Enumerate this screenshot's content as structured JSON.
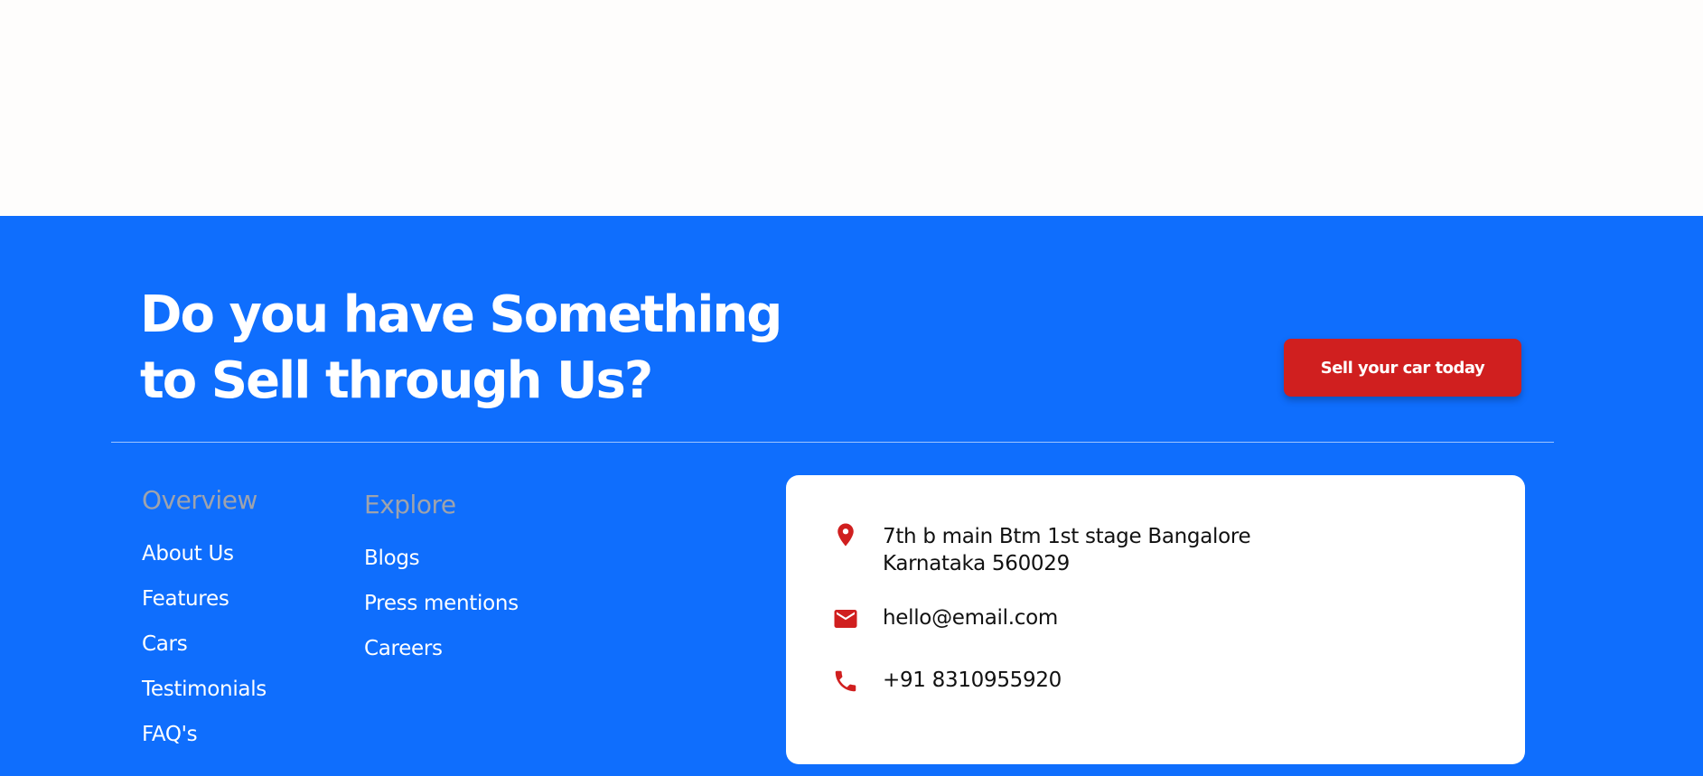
{
  "cta": {
    "heading_line1": "Do you have Something",
    "heading_line2": "to Sell through Us?",
    "button_label": "Sell your car today"
  },
  "footer": {
    "overview": {
      "heading": "Overview",
      "links": [
        "About Us",
        "Features",
        "Cars",
        "Testimonials",
        "FAQ's"
      ]
    },
    "explore": {
      "heading": "Explore",
      "links": [
        "Blogs",
        "Press mentions",
        "Careers"
      ]
    },
    "contact": {
      "address_line1": "7th b main Btm 1st stage Bangalore",
      "address_line2": "Karnataka 560029",
      "email": "hello@email.com",
      "phone": "+91 8310955920",
      "icons": [
        "location-pin-icon",
        "mail-icon",
        "phone-icon"
      ]
    }
  },
  "colors": {
    "footer_bg": "#0f6efd",
    "button_bg": "#d01f1f",
    "icon_color": "#d01f1f",
    "column_heading": "#9ea3ad"
  }
}
